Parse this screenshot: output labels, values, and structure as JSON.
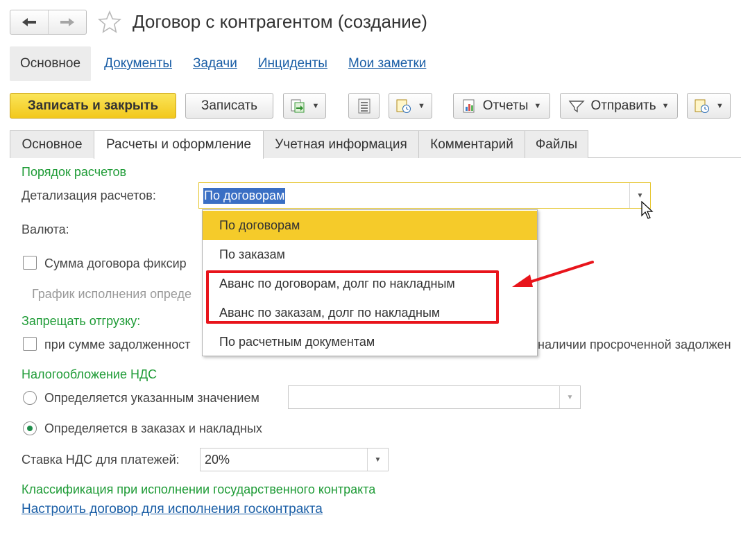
{
  "window": {
    "title": "Договор с контрагентом (создание)"
  },
  "panel_nav": [
    "Основное",
    "Документы",
    "Задачи",
    "Инциденты",
    "Мои заметки"
  ],
  "toolbar": {
    "save_close": "Записать и закрыть",
    "save": "Записать",
    "reports": "Отчеты",
    "send": "Отправить"
  },
  "tabs": [
    "Основное",
    "Расчеты и оформление",
    "Учетная информация",
    "Комментарий",
    "Файлы"
  ],
  "form": {
    "section_payment_order": "Порядок расчетов",
    "detail_label": "Детализация расчетов:",
    "detail_value": "По договорам",
    "currency_label": "Валюта:",
    "fixed_sum_label": "Сумма договора фиксир",
    "schedule_label": "График исполнения опреде",
    "prohibit_shipping": "Запрещать отгрузку:",
    "debt_sum_label": "при сумме задолженност",
    "overdue_label": "наличии просроченной задолжен",
    "vat_section": "Налогообложение НДС",
    "vat_option1": "Определяется указанным значением",
    "vat_option2": "Определяется в заказах и накладных",
    "vat_rate_label": "Ставка НДС для платежей:",
    "vat_rate_value": "20%",
    "classification_title": "Классификация при исполнении государственного контракта",
    "config_link": "Настроить договор для исполнения госконтракта"
  },
  "dropdown": {
    "options": [
      "По договорам",
      "По заказам",
      "Аванс по договорам, долг по накладным",
      "Аванс по заказам, долг по накладным",
      "По расчетным документам"
    ],
    "selected_index": 0
  },
  "colors": {
    "accent_green": "#1e9b36",
    "link_blue": "#1a5ea6",
    "primary_yellow": "#f5cb2a",
    "highlight_red": "#e8141b"
  }
}
